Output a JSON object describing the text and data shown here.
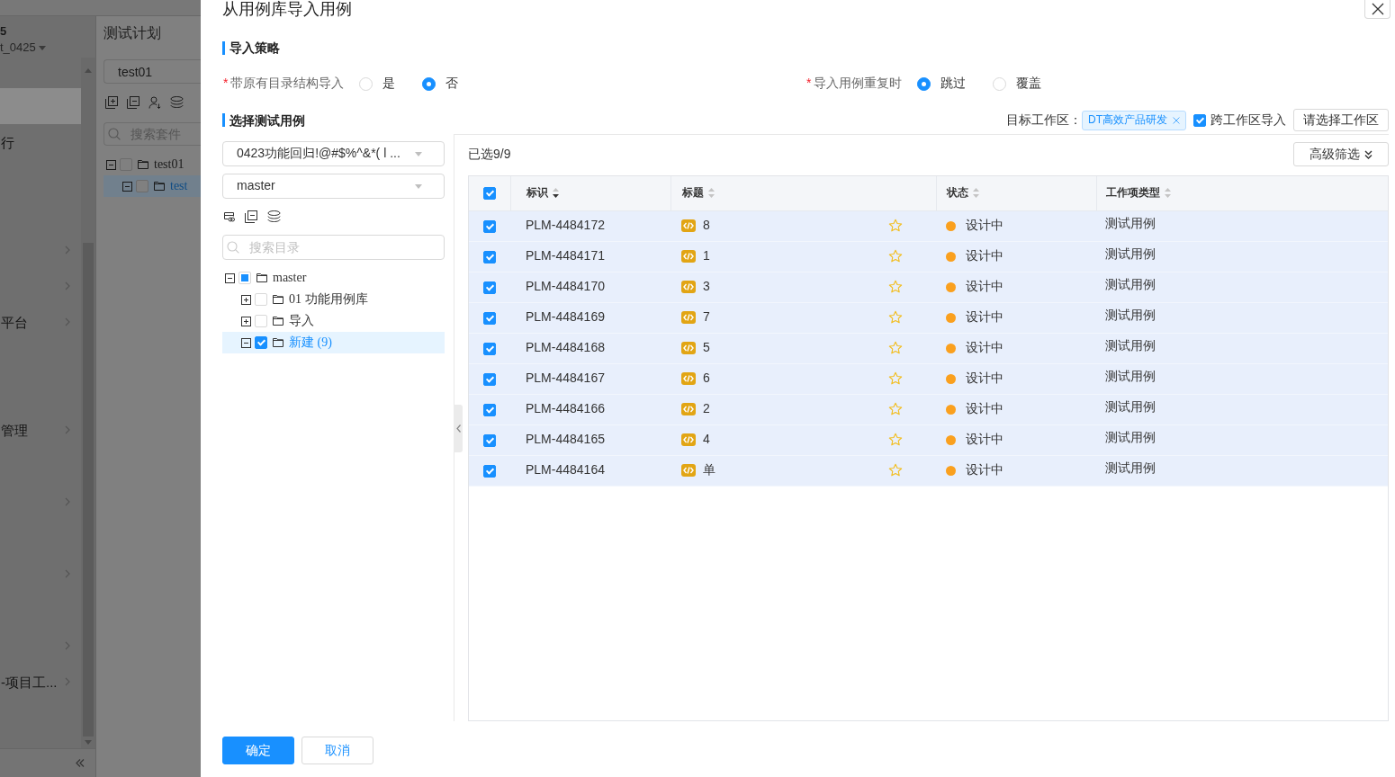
{
  "app": {
    "sidebar": {
      "title": "5",
      "project": "t_0425",
      "items": [
        {
          "selected": true,
          "submenu": false
        },
        {
          "label": "行",
          "selected": false,
          "submenu": false
        },
        {
          "selected": false,
          "submenu": false
        },
        {
          "selected": false,
          "submenu": false
        },
        {
          "selected": false,
          "submenu": true
        },
        {
          "selected": false,
          "submenu": true
        },
        {
          "label": "平台",
          "selected": false,
          "submenu": true
        },
        {
          "selected": false,
          "submenu": false
        },
        {
          "selected": false,
          "submenu": false
        },
        {
          "label": "管理",
          "selected": false,
          "submenu": true
        },
        {
          "selected": false,
          "submenu": false
        },
        {
          "selected": false,
          "submenu": true
        },
        {
          "selected": false,
          "submenu": false
        },
        {
          "selected": false,
          "submenu": true
        },
        {
          "selected": false,
          "submenu": false
        },
        {
          "selected": false,
          "submenu": true
        },
        {
          "label": "-项目工...",
          "selected": false,
          "submenu": true
        }
      ]
    },
    "plan_panel": {
      "title": "测试计划",
      "plan_field": {
        "value": "test01"
      },
      "search": {
        "placeholder": "搜索套件"
      },
      "tree": [
        {
          "label": "test01",
          "expanded": true,
          "checked": false,
          "partial": false,
          "selected": false,
          "children": [
            {
              "label": "test",
              "expanded": true,
              "checked": false,
              "partial": false,
              "selected": true
            }
          ]
        }
      ]
    }
  },
  "dialog": {
    "title": "从用例库导入用例",
    "strategy": {
      "heading": "导入策略",
      "options": [
        {
          "required_mark": "*",
          "label": "带原有目录结构导入",
          "choices": [
            {
              "label": "是",
              "selected": false
            },
            {
              "label": "否",
              "selected": true
            }
          ]
        },
        {
          "required_mark": "*",
          "label": "导入用例重复时",
          "choices": [
            {
              "label": "跳过",
              "selected": true
            },
            {
              "label": "覆盖",
              "selected": false
            }
          ]
        }
      ]
    },
    "selection": {
      "heading": "选择测试用例",
      "target_label": "目标工作区：",
      "target_tag": "DT高效产品研发",
      "cross_workspace": {
        "label": "跨工作区导入",
        "checked": true
      },
      "choose_button": "请选择工作区"
    },
    "library": {
      "repository": "0423功能回归!@#$%^&*( l ...",
      "branch": "master",
      "search": {
        "placeholder": "搜索目录"
      },
      "tree": [
        {
          "label": "master",
          "expanded": true,
          "checked": false,
          "partial": true,
          "selected": false,
          "children": [
            {
              "label": "01 功能用例库",
              "expanded": false,
              "checked": false,
              "partial": false,
              "selected": false
            },
            {
              "label": "导入",
              "expanded": false,
              "checked": false,
              "partial": false,
              "selected": false
            },
            {
              "label": "新建 (9)",
              "expanded": true,
              "checked": true,
              "partial": false,
              "selected": true
            }
          ]
        }
      ]
    },
    "cases": {
      "selected_count": "已选9/9",
      "filter_button": "高级筛选",
      "all_checked": true,
      "columns": [
        {
          "label": "标识",
          "sorted": true
        },
        {
          "label": "标题",
          "sorted": false
        },
        {
          "label": "状态",
          "sorted": false
        },
        {
          "label": "工作项类型",
          "sorted": false
        }
      ],
      "rows": [
        {
          "checked": true,
          "id": "PLM-4484172",
          "title": "8",
          "starred": false,
          "status": "设计中",
          "color": "#faa01e",
          "type": "测试用例"
        },
        {
          "checked": true,
          "id": "PLM-4484171",
          "title": "1",
          "starred": false,
          "status": "设计中",
          "color": "#faa01e",
          "type": "测试用例"
        },
        {
          "checked": true,
          "id": "PLM-4484170",
          "title": "3",
          "starred": false,
          "status": "设计中",
          "color": "#faa01e",
          "type": "测试用例"
        },
        {
          "checked": true,
          "id": "PLM-4484169",
          "title": "7",
          "starred": false,
          "status": "设计中",
          "color": "#faa01e",
          "type": "测试用例"
        },
        {
          "checked": true,
          "id": "PLM-4484168",
          "title": "5",
          "starred": false,
          "status": "设计中",
          "color": "#faa01e",
          "type": "测试用例"
        },
        {
          "checked": true,
          "id": "PLM-4484167",
          "title": "6",
          "starred": false,
          "status": "设计中",
          "color": "#faa01e",
          "type": "测试用例"
        },
        {
          "checked": true,
          "id": "PLM-4484166",
          "title": "2",
          "starred": false,
          "status": "设计中",
          "color": "#faa01e",
          "type": "测试用例"
        },
        {
          "checked": true,
          "id": "PLM-4484165",
          "title": "4",
          "starred": false,
          "status": "设计中",
          "color": "#faa01e",
          "type": "测试用例"
        },
        {
          "checked": true,
          "id": "PLM-4484164",
          "title": "单",
          "starred": false,
          "status": "设计中",
          "color": "#faa01e",
          "type": "测试用例"
        }
      ]
    },
    "buttons": [
      {
        "label": "确定",
        "kind": "primary"
      },
      {
        "label": "取消",
        "kind": "secondary"
      }
    ]
  }
}
